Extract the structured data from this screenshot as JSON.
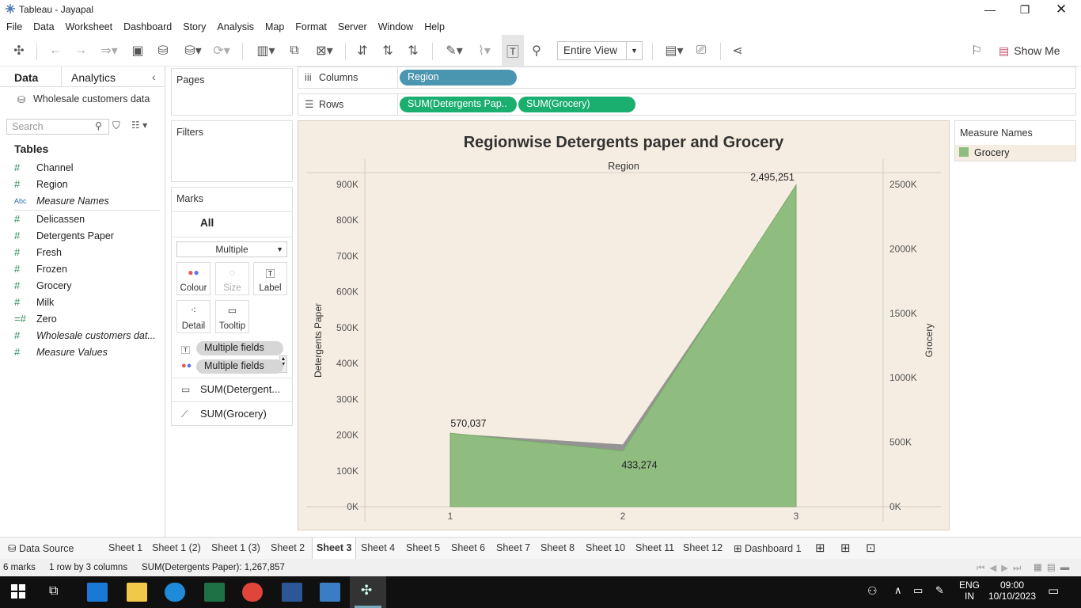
{
  "window": {
    "title": "Tableau - Jayapal"
  },
  "menu": [
    "File",
    "Data",
    "Worksheet",
    "Dashboard",
    "Story",
    "Analysis",
    "Map",
    "Format",
    "Server",
    "Window",
    "Help"
  ],
  "toolbar": {
    "fit": "Entire View",
    "show_me": "Show Me"
  },
  "left": {
    "tab_data": "Data",
    "tab_analytics": "Analytics",
    "datasource": "Wholesale customers data",
    "search_placeholder": "Search",
    "tables_heading": "Tables",
    "fields": [
      {
        "name": "Channel",
        "type": "#"
      },
      {
        "name": "Region",
        "type": "#"
      },
      {
        "name": "Measure Names",
        "type": "Abc"
      },
      {
        "name": "Delicassen",
        "type": "#"
      },
      {
        "name": "Detergents Paper",
        "type": "#"
      },
      {
        "name": "Fresh",
        "type": "#"
      },
      {
        "name": "Frozen",
        "type": "#"
      },
      {
        "name": "Grocery",
        "type": "#"
      },
      {
        "name": "Milk",
        "type": "#"
      },
      {
        "name": "Zero",
        "type": "=#"
      },
      {
        "name": "Wholesale customers dat...",
        "type": "#"
      },
      {
        "name": "Measure Values",
        "type": "#"
      }
    ]
  },
  "cards": {
    "pages": "Pages",
    "filters": "Filters",
    "marks": "Marks",
    "marks_all": "All",
    "mark_type": "Multiple",
    "colour": "Colour",
    "size": "Size",
    "label": "Label",
    "detail": "Detail",
    "tooltip": "Tooltip",
    "field1": "Multiple fields",
    "field2": "Multiple fields",
    "measure1": "SUM(Detergent...",
    "measure2": "SUM(Grocery)"
  },
  "shelves": {
    "columns_label": "Columns",
    "rows_label": "Rows",
    "columns_pill": "Region",
    "rows_pill1": "SUM(Detergents Pap..",
    "rows_pill2": "SUM(Grocery)"
  },
  "legend": {
    "title": "Measure Names",
    "item": "Grocery",
    "item_color": "#8fbc7f"
  },
  "chart_data": {
    "type": "area",
    "title": "Regionwise Detergents paper and Grocery",
    "xlabel": "Region",
    "x": [
      "1",
      "2",
      "3"
    ],
    "series": [
      {
        "name": "Detergents Paper",
        "values": [
          204136,
          173777,
          889469
        ],
        "color": "#8f8f8f",
        "axis": "left"
      },
      {
        "name": "Grocery",
        "values": [
          570037,
          433274,
          2495251
        ],
        "color": "#8fbc7f",
        "axis": "right"
      }
    ],
    "data_labels": [
      "570,037",
      "433,274",
      "2,495,251"
    ],
    "left_axis": {
      "label": "Detergents Paper",
      "ylim": [
        0,
        900000
      ],
      "ticks": [
        "0K",
        "100K",
        "200K",
        "300K",
        "400K",
        "500K",
        "600K",
        "700K",
        "800K",
        "900K"
      ]
    },
    "right_axis": {
      "label": "Grocery",
      "ylim": [
        0,
        2500000
      ],
      "ticks": [
        "0K",
        "500K",
        "1000K",
        "1500K",
        "2000K",
        "2500K"
      ]
    },
    "background": "#f5ede1"
  },
  "sheets": {
    "data_source": "Data Source",
    "tabs": [
      "Sheet 1",
      "Sheet 1 (2)",
      "Sheet 1 (3)",
      "Sheet 2",
      "Sheet 3",
      "Sheet 4",
      "Sheet 5",
      "Sheet 6",
      "Sheet 7",
      "Sheet 8",
      "Sheet 10",
      "Sheet 11",
      "Sheet 12",
      "Dashboard 1"
    ],
    "active": "Sheet 3"
  },
  "status": {
    "marks": "6 marks",
    "dims": "1 row  by  3 columns",
    "sum": "SUM(Detergents Paper): 1,267,857"
  },
  "taskbar": {
    "lang1": "ENG",
    "lang2": "IN",
    "time": "09:00",
    "date": "10/10/2023"
  }
}
